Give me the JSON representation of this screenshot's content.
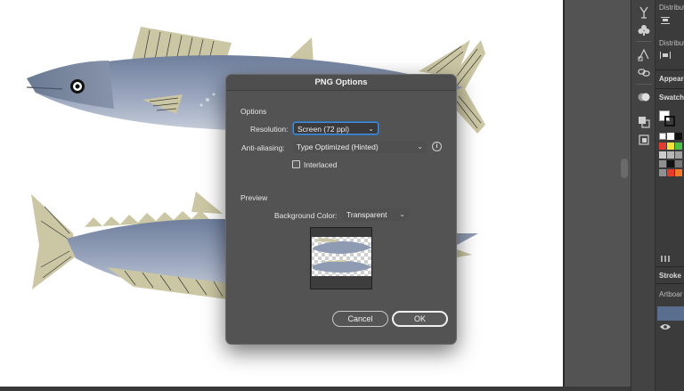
{
  "dialog": {
    "title": "PNG Options",
    "options_heading": "Options",
    "resolution_label": "Resolution:",
    "resolution_value": "Screen (72 ppi)",
    "antialiasing_label": "Anti-aliasing:",
    "antialiasing_value": "Type Optimized (Hinted)",
    "interlaced_label": "Interlaced",
    "interlaced_checked": false,
    "preview_heading": "Preview",
    "bg_color_label": "Background Color:",
    "bg_color_value": "Transparent",
    "cancel_label": "Cancel",
    "ok_label": "OK"
  },
  "panels": {
    "distribute_1": "Distributi",
    "distribute_2": "Distributi",
    "appearance": "Appeara",
    "swatches": "Swatche",
    "stroke": "Stroke",
    "artboards": "Artboar"
  },
  "icons": {
    "tools": [
      "puppet-warp-icon",
      "club-symbol-icon",
      "transform-icon",
      "link-icon",
      "appearance-icon",
      "pathfinder-icon",
      "artboard-icon"
    ],
    "dialog_info": "info-icon",
    "chevron": "chevron-down-icon",
    "visibility": "eye-icon"
  },
  "colors": {
    "fish_body": "#8f9bb3",
    "fish_fin": "#cbc6a3",
    "dialog_bg": "#535353",
    "focus_blue": "#4a90d9",
    "swatch_red": "#e23b2f",
    "swatch_yellow": "#f2e23a",
    "swatch_green": "#4fbf4a"
  }
}
